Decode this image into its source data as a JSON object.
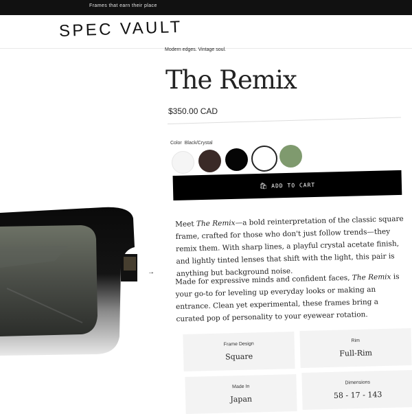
{
  "announcement": "Frames that earn their place",
  "brand": "SPEC VAULT",
  "product": {
    "tagline": "Modern edges. Vintage soul.",
    "title": "The Remix",
    "price": "$350.00 CAD",
    "color_label": "Color",
    "color_value": "Black/Crystal",
    "swatches": [
      {
        "name": "white",
        "color": "#f5f5f5"
      },
      {
        "name": "dark-brown",
        "color": "#3a2a27"
      },
      {
        "name": "black",
        "color": "#050505"
      },
      {
        "name": "black-crystal",
        "color": "#ffffff",
        "selected": true
      },
      {
        "name": "green",
        "color": "#7f9a6e"
      }
    ],
    "cart_label": "ADD TO CART",
    "desc1": {
      "a": "Meet ",
      "em": "The Remix",
      "b": "—a bold reinterpretation of the classic square frame, crafted for those who don't just follow trends—they remix them. With sharp lines, a playful crystal acetate finish, and lightly tinted lenses that shift with the light, this pair is anything but background noise."
    },
    "desc2": {
      "a": "Made for expressive minds and confident faces, ",
      "em": "The Remix",
      "b": " is your go-to for leveling up everyday looks or making an entrance. Clean yet experimental, these frames bring a curated pop of personality to your eyewear rotation."
    },
    "specs": [
      {
        "label": "Frame Design",
        "value": "Square"
      },
      {
        "label": "Rim",
        "value": "Full-Rim"
      },
      {
        "label": "Made In",
        "value": "Japan"
      },
      {
        "label": "Dimensions",
        "value": "58 - 17 - 143"
      }
    ]
  },
  "gallery": {
    "next_arrow": "→"
  }
}
